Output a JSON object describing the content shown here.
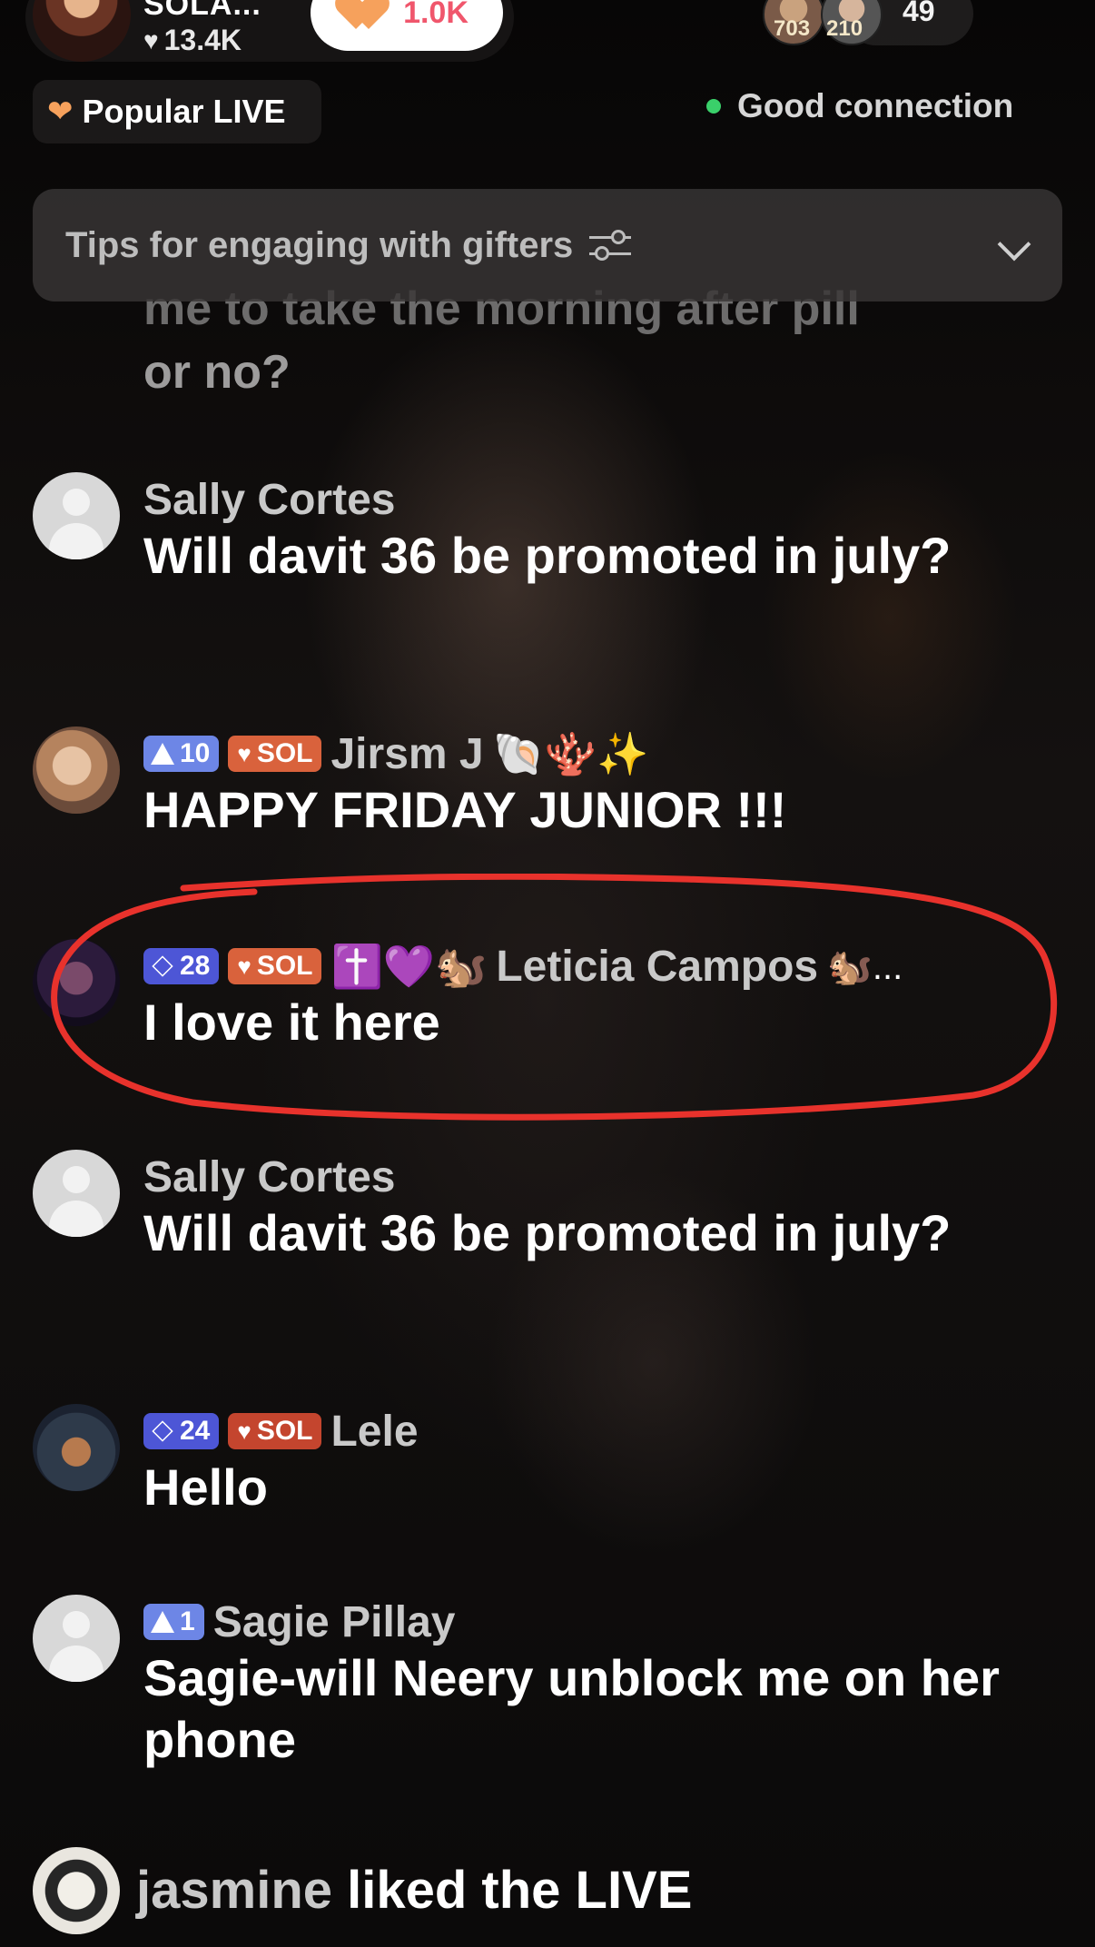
{
  "header": {
    "host_name": "SOLA...",
    "host_likes": "13.4K",
    "gift_count": "1.0K",
    "viewer_badge_1": "703",
    "viewer_badge_2": "210",
    "viewer_total": "49",
    "popular_label": "Popular LIVE",
    "connection_status": "Good connection",
    "connection_color": "#3ad06a"
  },
  "tips": {
    "label": "Tips for engaging with gifters"
  },
  "clipped_comment": {
    "line1": "me to take the morning after pill",
    "line2": "or no?"
  },
  "comments": [
    {
      "user": "Sally Cortes",
      "text": "Will davit 36 be promoted in july?"
    },
    {
      "user": "Jirsm J",
      "level": "10",
      "sol": "SOL",
      "emojis": "🐚🪸✨",
      "text": "HAPPY FRIDAY JUNIOR !!!"
    },
    {
      "user": "Leticia Campos",
      "level": "28",
      "sol": "SOL",
      "prefix_emojis": "✝️💜🐿️",
      "suffix": "🐿️...",
      "text": "I love it here"
    },
    {
      "user": "Sally Cortes",
      "text": "Will davit 36 be promoted in july?"
    },
    {
      "user": "Lele",
      "level": "24",
      "sol": "SOL",
      "text": "Hello"
    },
    {
      "user": "Sagie Pillay",
      "level": "1",
      "text": "Sagie-will Neery unblock me on her phone"
    }
  ],
  "footer": {
    "user": "jasmine",
    "action": " liked the LIVE"
  },
  "colors": {
    "accent_orange": "#f6a15c",
    "gift_red": "#f0566c",
    "level_blue": "#4d56d6",
    "sol_orange": "#d9623c",
    "highlight_red": "#e8322c"
  }
}
